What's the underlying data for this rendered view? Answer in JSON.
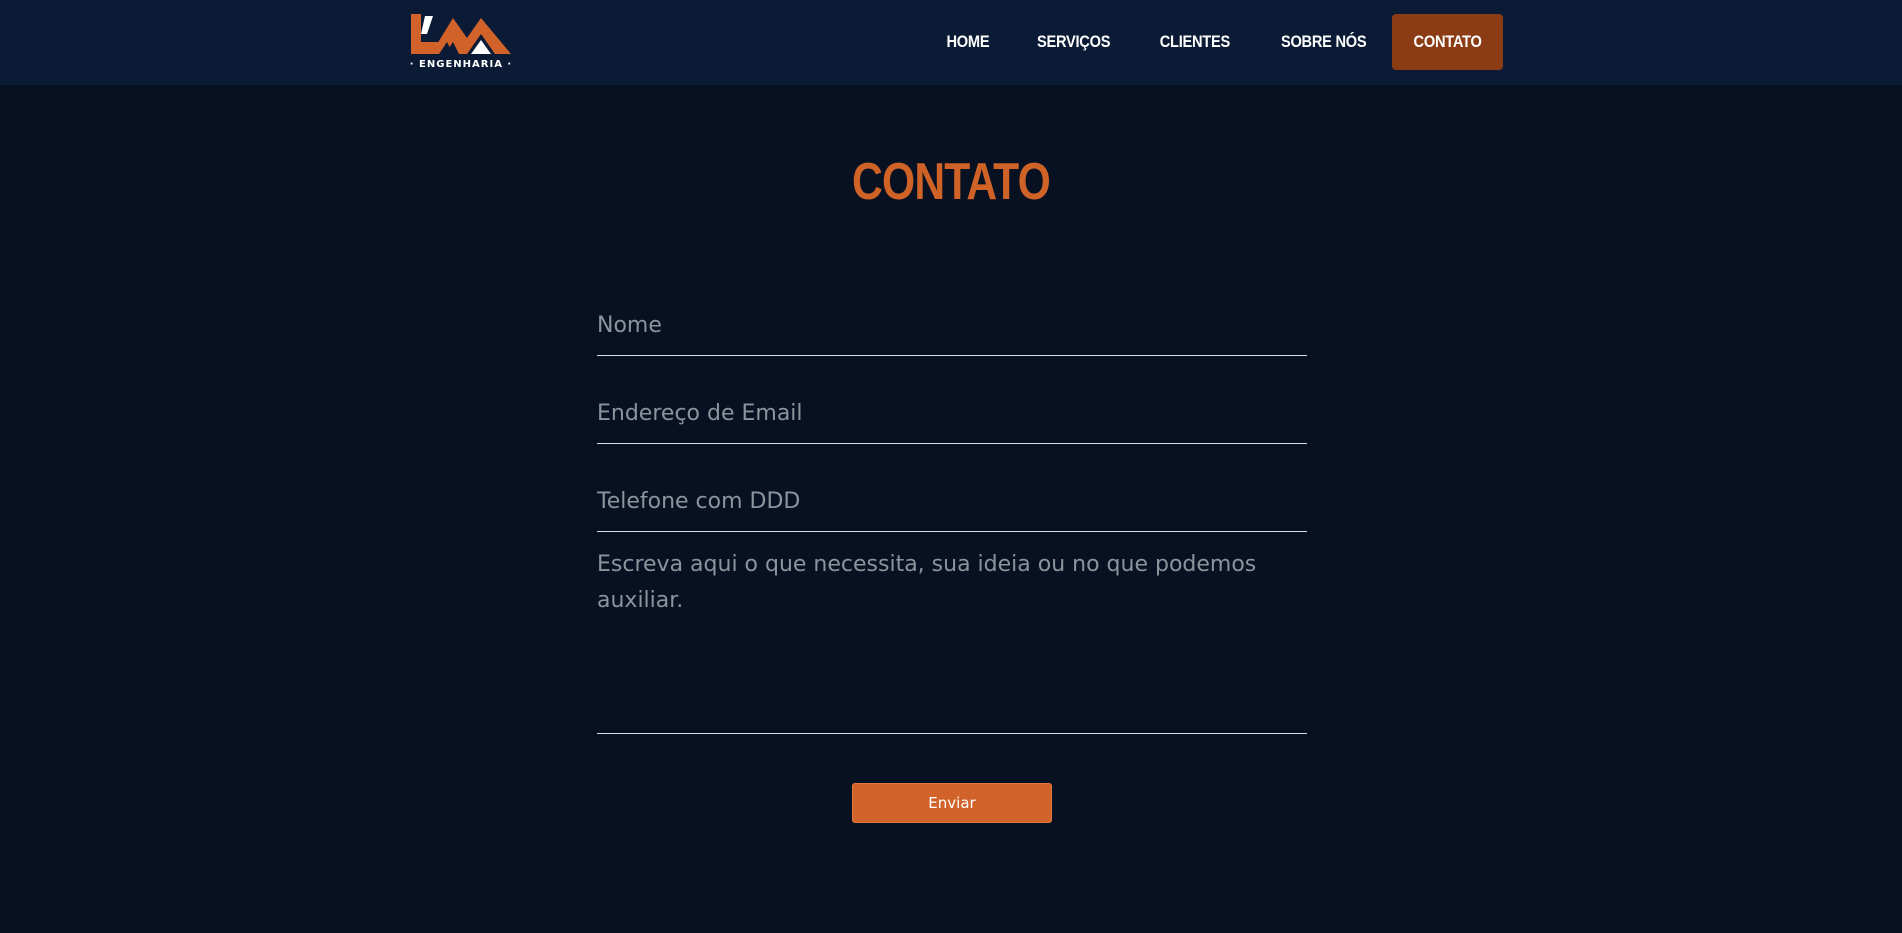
{
  "brand": {
    "logo_icon": "lm-mountain-logo",
    "tagline": "· ENGENHARIA ·",
    "colors": {
      "accent": "#cf6226",
      "navbar": "#0b1b35",
      "background": "#081121",
      "active_nav": "#8b3c14"
    }
  },
  "nav": {
    "items": [
      {
        "label": "HOME"
      },
      {
        "label": "SERVIÇOS"
      },
      {
        "label": "CLIENTES"
      },
      {
        "label": "SOBRE NÓS"
      },
      {
        "label": "CONTATO"
      }
    ],
    "active": "CONTATO"
  },
  "page": {
    "title": "CONTATO"
  },
  "form": {
    "name_placeholder": "Nome",
    "email_placeholder": "Endereço de Email",
    "phone_placeholder": "Telefone com DDD",
    "message_placeholder": "Escreva aqui o que necessita, sua ideia ou no que podemos auxiliar.",
    "submit_label": "Enviar"
  }
}
